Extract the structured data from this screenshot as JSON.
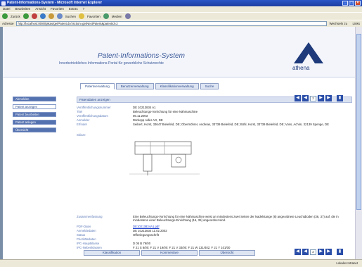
{
  "window": {
    "title": "Patent-Informations-System - Microsoft Internet Explorer"
  },
  "menu": [
    "Datei",
    "Bearbeiten",
    "Ansicht",
    "Favoriten",
    "Extras",
    "?"
  ],
  "toolbar": {
    "back": "Zurück",
    "search": "Suchen",
    "favorites": "Favoriten",
    "media": "Medien"
  },
  "address": {
    "label": "Adresse",
    "url": "http://localhost:8080/jakas/getPatent.do?action=getNextPatent&patentId=2",
    "go": "Wechseln zu",
    "links": "Links"
  },
  "header": {
    "title": "Patent-Informations-System",
    "subtitle": "Innerbetriebliches Informations-Portal für gewerbliche Schutzrechte",
    "logo_text": "athena"
  },
  "tabs": [
    "Patentverwaltung",
    "Benutzerverwaltung",
    "Klassifikationverwaltung",
    "Suche"
  ],
  "sidebar": [
    "Abmelden",
    "Patent anzeigen",
    "Patent bearbeiten",
    "Patent anlegen",
    "Übersicht"
  ],
  "section_title": "Patentdaten anzeigen",
  "pager": {
    "page": "2"
  },
  "fields": {
    "veroeffnr_label": "Veröffentlichungsnummer",
    "veroeffnr": "DE 10213834 A1",
    "titel_label": "Titel",
    "titel": "Beleuchtungs-Vorrichtung für eine Nähmaschine",
    "datum_label": "Veröffentlichungsdatum",
    "datum": "06.11.2003",
    "anmelder_label": "Anmelder",
    "anmelder": "Dürkopp Adler AG, DE",
    "erfinder_label": "Erfinder",
    "erfinder1": "Seibert, Horst, 33647 Bielefeld, DE; Obermöhrer, Andreas, 33739 Bielefeld, DE; Böhl, Horst, 33739 Bielefeld, DE; Voss, Achim, 32139 Spenge, DE",
    "skizze_label": "Skizze",
    "zusammenfassung_label": "Zusammenfassung",
    "zusammenfassung": "Eine Beleuchtungs-Vorrichtung für eine Nähmaschine weist an mindestens zwei Seiten der Nadelstange (8) angeordnete Leuchtdioden (36, 37) auf, die in mindestens einer Beleuchtungs-Einrichtung (16, 35) angeordnet sind.",
    "pdf_label": "PDF-Datei",
    "pdf": "DE10213834A1.pdf",
    "anmeldedaten_label": "Anmeldedaten",
    "anmeldedaten": "DE 10213834 11.02.2002",
    "status_label": "Status",
    "status": "Offenlegungsschrift",
    "prio_label": "Prioritätsdaten",
    "prio": "",
    "ipc_haupt_label": "IPC-Hauptklasse",
    "ipc_haupt": "D 05 B 79/00",
    "ipc_neben_label": "IPC-Nebenklassen",
    "ipc_neben": "F 21 S 8/00; F 21 V 19/00; F 21 V 33/00; F 21 W 131/402; F 21 Y 101/00"
  },
  "bottom_buttons": [
    "Klassifikation",
    "Kommentare",
    "Übersicht"
  ],
  "status_bar": {
    "left": "",
    "zone": "Lokales Intranet"
  },
  "colors": {
    "accent": "#2a4ea8",
    "label": "#5a78b8",
    "link": "#1a3ccc"
  }
}
